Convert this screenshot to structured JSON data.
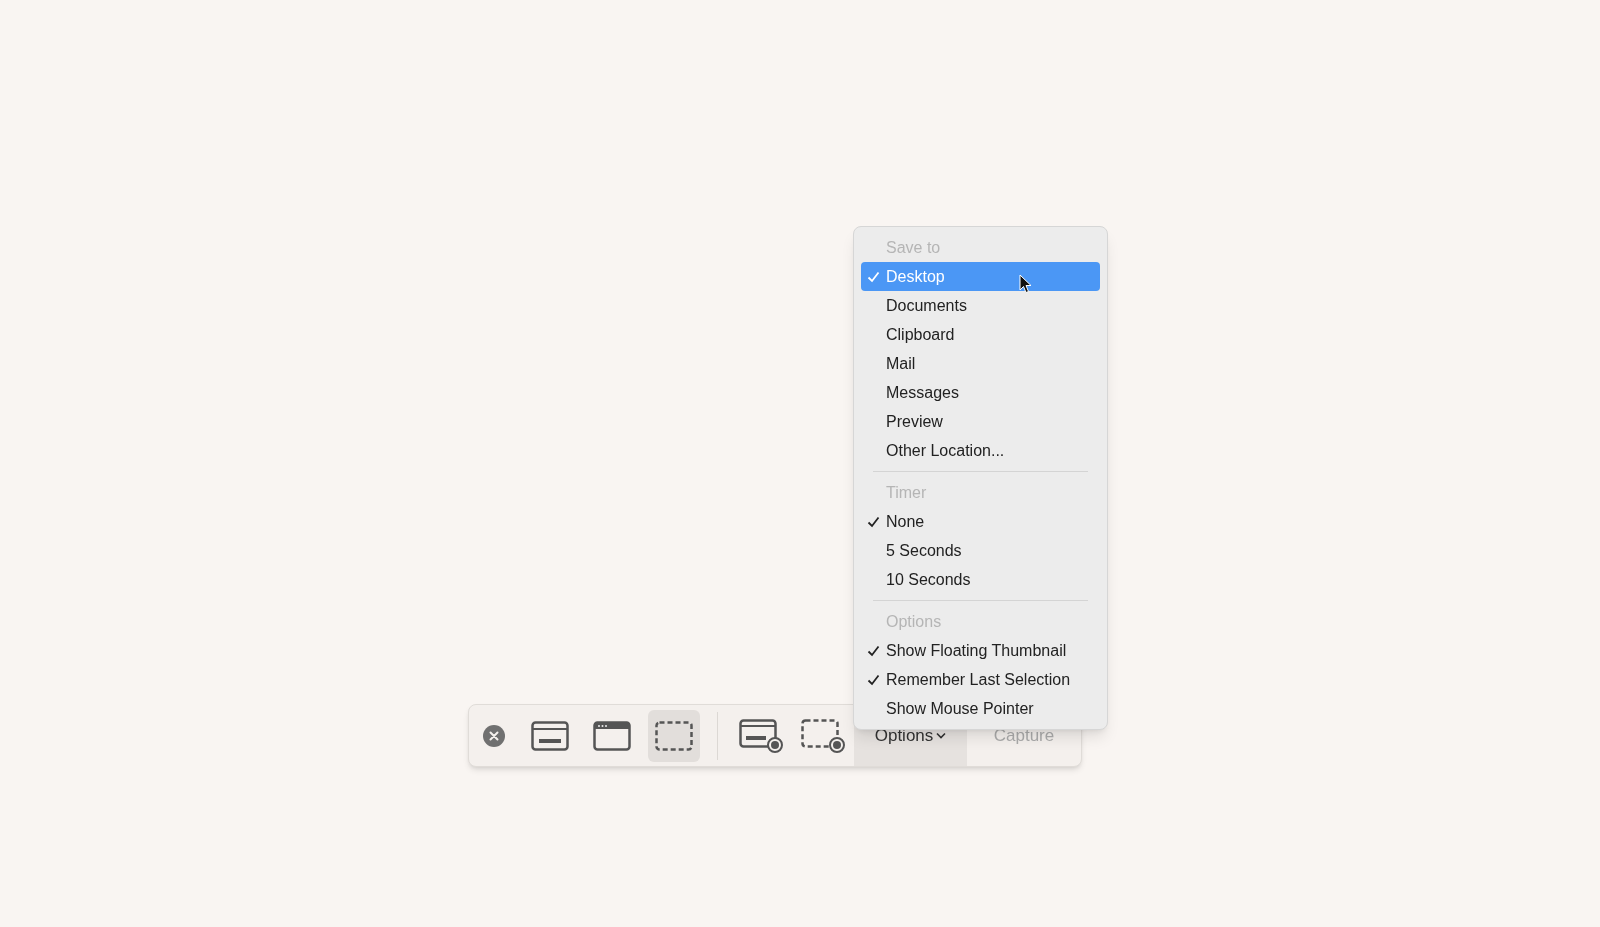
{
  "toolbar": {
    "tools": [
      {
        "kind": "close"
      },
      {
        "kind": "screen",
        "selected": false
      },
      {
        "kind": "window",
        "selected": false
      },
      {
        "kind": "selection",
        "selected": true
      },
      {
        "kind": "divider"
      },
      {
        "kind": "record-screen",
        "selected": false
      },
      {
        "kind": "record-selection",
        "selected": false
      }
    ],
    "options_button": {
      "label": "Options",
      "open": true
    },
    "capture_button": {
      "label": "Capture"
    }
  },
  "menu": {
    "sections": [
      {
        "header": "Save to",
        "items": [
          {
            "label": "Desktop",
            "checked": true,
            "highlighted": true
          },
          {
            "label": "Documents",
            "checked": false,
            "highlighted": false
          },
          {
            "label": "Clipboard",
            "checked": false,
            "highlighted": false
          },
          {
            "label": "Mail",
            "checked": false,
            "highlighted": false
          },
          {
            "label": "Messages",
            "checked": false,
            "highlighted": false
          },
          {
            "label": "Preview",
            "checked": false,
            "highlighted": false
          },
          {
            "label": "Other Location...",
            "checked": false,
            "highlighted": false
          }
        ]
      },
      {
        "header": "Timer",
        "items": [
          {
            "label": "None",
            "checked": true,
            "highlighted": false
          },
          {
            "label": "5 Seconds",
            "checked": false,
            "highlighted": false
          },
          {
            "label": "10 Seconds",
            "checked": false,
            "highlighted": false
          }
        ]
      },
      {
        "header": "Options",
        "items": [
          {
            "label": "Show Floating Thumbnail",
            "checked": true,
            "highlighted": false
          },
          {
            "label": "Remember Last Selection",
            "checked": true,
            "highlighted": false
          },
          {
            "label": "Show Mouse Pointer",
            "checked": false,
            "highlighted": false
          }
        ]
      }
    ]
  }
}
